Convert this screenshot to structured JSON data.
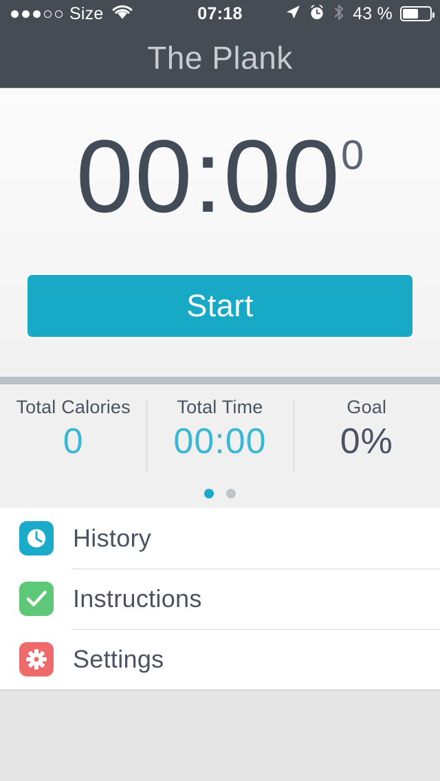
{
  "status_bar": {
    "carrier": "Size",
    "signal_dots_filled": 3,
    "signal_dots_total": 5,
    "wifi_icon": "wifi-icon",
    "time": "07:18",
    "location_icon": "location-arrow-icon",
    "alarm_icon": "alarm-clock-icon",
    "bluetooth_icon": "bluetooth-icon",
    "battery_percent_label": "43 %",
    "battery_level": 55,
    "bar_color": "#464c54",
    "text_color": "#ffffff"
  },
  "navbar": {
    "title": "The Plank",
    "background": "#464c54",
    "title_color": "#c9cccf"
  },
  "timer": {
    "main": "00:00",
    "fraction": "0",
    "color": "#424b58"
  },
  "start_button": {
    "label": "Start",
    "background": "#18a9c6",
    "text_color": "#ffffff"
  },
  "stats": {
    "items": [
      {
        "label": "Total Calories",
        "value": "0",
        "value_color": "#3ab7d4",
        "tone": "teal"
      },
      {
        "label": "Total Time",
        "value": "00:00",
        "value_color": "#3ab7d4",
        "tone": "teal"
      },
      {
        "label": "Goal",
        "value": "0%",
        "value_color": "#4a5361",
        "tone": "slate"
      }
    ],
    "pages": 2,
    "active_page": 1,
    "active_dot_color": "#1aabcb",
    "inactive_dot_color": "#bfc3c7"
  },
  "menu": {
    "items": [
      {
        "label": "History",
        "icon": "clock-icon",
        "icon_color": "#1aabcb"
      },
      {
        "label": "Instructions",
        "icon": "checkmark-icon",
        "icon_color": "#5cc878"
      },
      {
        "label": "Settings",
        "icon": "gear-icon",
        "icon_color": "#ef6a6a"
      }
    ]
  }
}
